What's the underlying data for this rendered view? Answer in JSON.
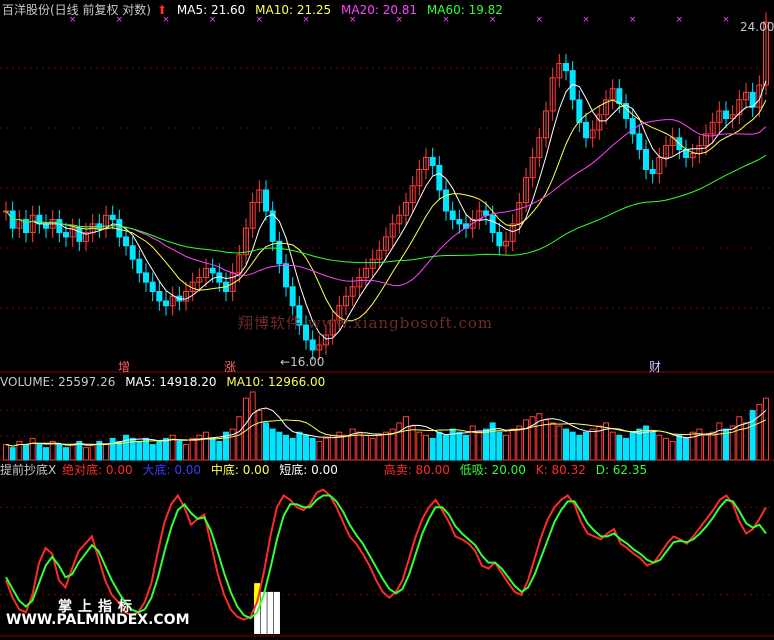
{
  "colors": {
    "up": "#ff3c3c",
    "down": "#00e5ff",
    "ma5": "#ffffff",
    "ma10": "#ffff55",
    "ma20": "#ff44ff",
    "ma60": "#33ff33",
    "grid": "#7a0000",
    "text": "#c8c8c8"
  },
  "price_panel": {
    "title": "百洋股份(日线 前复权 对数)",
    "ma5": "MA5: 21.60",
    "ma10": "MA10: 21.25",
    "ma20": "MA20: 20.81",
    "ma60": "MA60: 19.82",
    "high_label": "24.00",
    "low_label": "16.00",
    "tags": [
      "增",
      "涨",
      "财"
    ]
  },
  "volume_panel": {
    "vol": "VOLUME: 25597.26",
    "ma5": "MA5: 14918.20",
    "ma10": "MA10: 12966.00"
  },
  "indicator_panel": {
    "name": "提前抄底X",
    "abs_bottom": "绝对底: 0.00",
    "big_bottom": "大底: 0.00",
    "mid_bottom": "中底: 0.00",
    "short_bottom": "短底: 0.00",
    "sell": "高卖: 80.00",
    "buy": "低吸: 20.00",
    "k": "K: 80.32",
    "d": "D: 62.35"
  },
  "watermark": "翔博软件 www.xiangbosoft.com",
  "brand_line1": "掌上指标",
  "brand_line2": "WWW.PALMINDEX.COM",
  "chart_data": [
    {
      "type": "candlestick",
      "title": "百洋股份(日线 前复权 对数)",
      "scale": "log",
      "ylim": [
        16.0,
        24.0
      ],
      "annotated_low": 16.0,
      "annotated_high": 24.0,
      "closes": [
        19.0,
        18.6,
        18.8,
        18.5,
        18.9,
        18.7,
        18.6,
        18.8,
        18.5,
        18.4,
        18.6,
        18.3,
        18.5,
        18.7,
        18.6,
        18.9,
        18.8,
        18.4,
        18.2,
        17.9,
        17.6,
        17.4,
        17.2,
        17.0,
        16.9,
        17.1,
        17.0,
        17.2,
        17.4,
        17.5,
        17.7,
        17.6,
        17.4,
        17.2,
        17.6,
        18.0,
        18.6,
        19.2,
        19.5,
        19.0,
        18.3,
        17.8,
        17.3,
        16.9,
        16.5,
        16.2,
        16.0,
        16.1,
        16.3,
        16.6,
        16.9,
        17.1,
        17.3,
        17.5,
        17.7,
        17.9,
        18.1,
        18.4,
        18.7,
        18.9,
        19.2,
        19.6,
        20.0,
        20.3,
        20.1,
        19.5,
        19.0,
        18.8,
        18.7,
        18.6,
        18.8,
        19.0,
        18.9,
        18.5,
        18.2,
        18.3,
        18.7,
        19.2,
        19.8,
        20.3,
        20.8,
        21.5,
        22.4,
        22.8,
        22.6,
        21.8,
        21.2,
        20.8,
        21.0,
        21.4,
        21.8,
        22.1,
        21.7,
        21.3,
        20.9,
        20.5,
        20.0,
        19.9,
        20.3,
        20.6,
        20.8,
        20.5,
        20.3,
        20.4,
        20.6,
        20.9,
        21.2,
        21.5,
        21.3,
        21.4,
        21.8,
        22.0,
        21.6,
        22.2,
        24.0
      ],
      "ma": [
        {
          "name": "MA5",
          "value": 21.6
        },
        {
          "name": "MA10",
          "value": 21.25
        },
        {
          "name": "MA20",
          "value": 20.81
        },
        {
          "name": "MA60",
          "value": 19.82
        }
      ]
    },
    {
      "type": "bar",
      "title": "VOLUME",
      "values": [
        5,
        4,
        6,
        5,
        7,
        5,
        4,
        6,
        5,
        4,
        5,
        6,
        4,
        5,
        6,
        5,
        7,
        6,
        8,
        7,
        6,
        7,
        5,
        6,
        7,
        8,
        6,
        5,
        7,
        8,
        9,
        7,
        6,
        9,
        10,
        14,
        20,
        22,
        16,
        12,
        10,
        9,
        8,
        7,
        9,
        8,
        7,
        6,
        7,
        8,
        9,
        8,
        10,
        9,
        8,
        7,
        8,
        9,
        10,
        12,
        14,
        11,
        9,
        8,
        7,
        9,
        8,
        10,
        9,
        8,
        11,
        9,
        10,
        12,
        9,
        8,
        10,
        11,
        13,
        14,
        15,
        13,
        12,
        11,
        10,
        9,
        8,
        9,
        10,
        11,
        12,
        9,
        8,
        7,
        9,
        10,
        11,
        9,
        8,
        7,
        6,
        8,
        7,
        9,
        10,
        8,
        9,
        12,
        10,
        11,
        14,
        12,
        16,
        18,
        20
      ],
      "ma": [
        {
          "name": "MA5",
          "value": 14918.2
        },
        {
          "name": "MA10",
          "value": 12966.0
        }
      ],
      "last": 25597.26
    },
    {
      "type": "line",
      "title": "提前抄底X",
      "ylim": [
        0,
        100
      ],
      "reference_lines": [
        20,
        80
      ],
      "series": [
        {
          "name": "K",
          "values": [
            30,
            18,
            10,
            8,
            20,
            42,
            52,
            48,
            30,
            25,
            38,
            50,
            55,
            60,
            45,
            30,
            20,
            15,
            8,
            6,
            8,
            15,
            28,
            50,
            70,
            82,
            88,
            80,
            68,
            72,
            75,
            55,
            35,
            20,
            10,
            5,
            3,
            5,
            15,
            35,
            60,
            80,
            88,
            85,
            80,
            78,
            82,
            90,
            92,
            88,
            80,
            70,
            60,
            55,
            48,
            40,
            30,
            22,
            18,
            22,
            30,
            45,
            60,
            72,
            80,
            85,
            78,
            70,
            60,
            58,
            55,
            50,
            40,
            38,
            42,
            35,
            28,
            22,
            20,
            30,
            45,
            60,
            72,
            80,
            85,
            88,
            82,
            70,
            62,
            60,
            58,
            62,
            65,
            55,
            52,
            48,
            45,
            40,
            42,
            48,
            55,
            60,
            58,
            55,
            60,
            66,
            72,
            78,
            85,
            88,
            82,
            70,
            62,
            65,
            72,
            80
          ]
        },
        {
          "name": "D",
          "values": [
            32,
            24,
            16,
            12,
            16,
            28,
            40,
            46,
            40,
            32,
            34,
            42,
            48,
            54,
            50,
            40,
            30,
            22,
            15,
            10,
            8,
            10,
            18,
            32,
            50,
            66,
            78,
            82,
            76,
            72,
            73,
            64,
            50,
            35,
            22,
            12,
            6,
            4,
            8,
            20,
            38,
            58,
            74,
            82,
            82,
            80,
            80,
            85,
            88,
            88,
            84,
            77,
            68,
            61,
            55,
            47,
            39,
            31,
            24,
            21,
            24,
            34,
            48,
            62,
            72,
            80,
            80,
            75,
            67,
            62,
            58,
            54,
            47,
            42,
            42,
            38,
            32,
            26,
            22,
            25,
            34,
            46,
            58,
            70,
            78,
            84,
            84,
            77,
            69,
            64,
            60,
            60,
            62,
            58,
            55,
            51,
            48,
            44,
            42,
            44,
            50,
            56,
            57,
            56,
            58,
            62,
            67,
            73,
            80,
            85,
            84,
            77,
            69,
            66,
            68,
            62
          ]
        }
      ],
      "K": 80.32,
      "D": 62.35
    }
  ]
}
